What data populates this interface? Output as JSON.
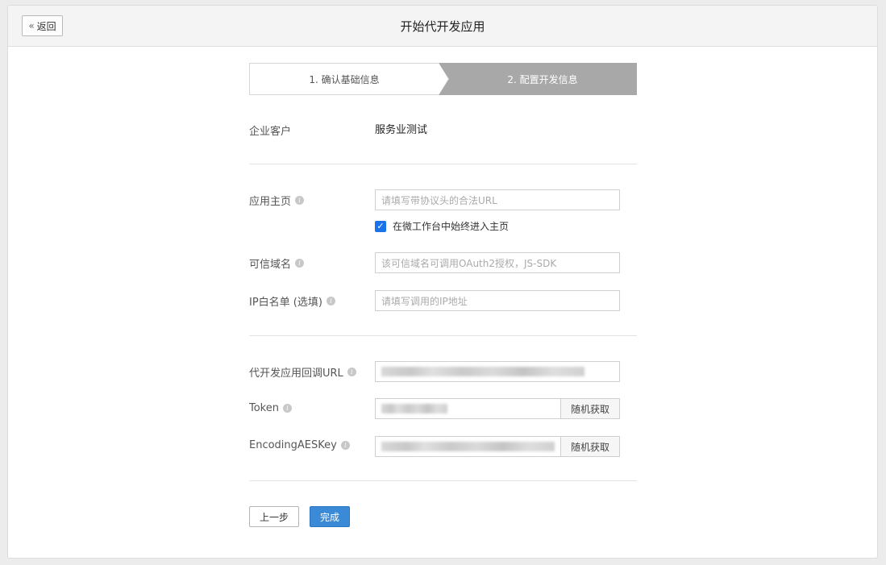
{
  "header": {
    "back_label": "返回",
    "title": "开始代开发应用"
  },
  "steps": [
    {
      "label": "1. 确认基础信息"
    },
    {
      "label": "2. 配置开发信息"
    }
  ],
  "customer": {
    "label": "企业客户",
    "value": "服务业测试"
  },
  "homepage": {
    "label": "应用主页",
    "placeholder": "请填写带协议头的合法URL",
    "checkbox_label": "在微工作台中始终进入主页",
    "checked": true
  },
  "trusted_domain": {
    "label": "可信域名",
    "placeholder": "该可信域名可调用OAuth2授权，JS-SDK"
  },
  "ip_whitelist": {
    "label": "IP白名单 (选填)",
    "placeholder": "请填写调用的IP地址"
  },
  "callback_url": {
    "label": "代开发应用回调URL"
  },
  "token": {
    "label": "Token",
    "random_label": "随机获取"
  },
  "aes_key": {
    "label": "EncodingAESKey",
    "random_label": "随机获取"
  },
  "actions": {
    "prev_label": "上一步",
    "done_label": "完成"
  },
  "colors": {
    "primary": "#3a8ad8",
    "step_active": "#a8a8a8",
    "checkbox": "#1a73e8"
  }
}
